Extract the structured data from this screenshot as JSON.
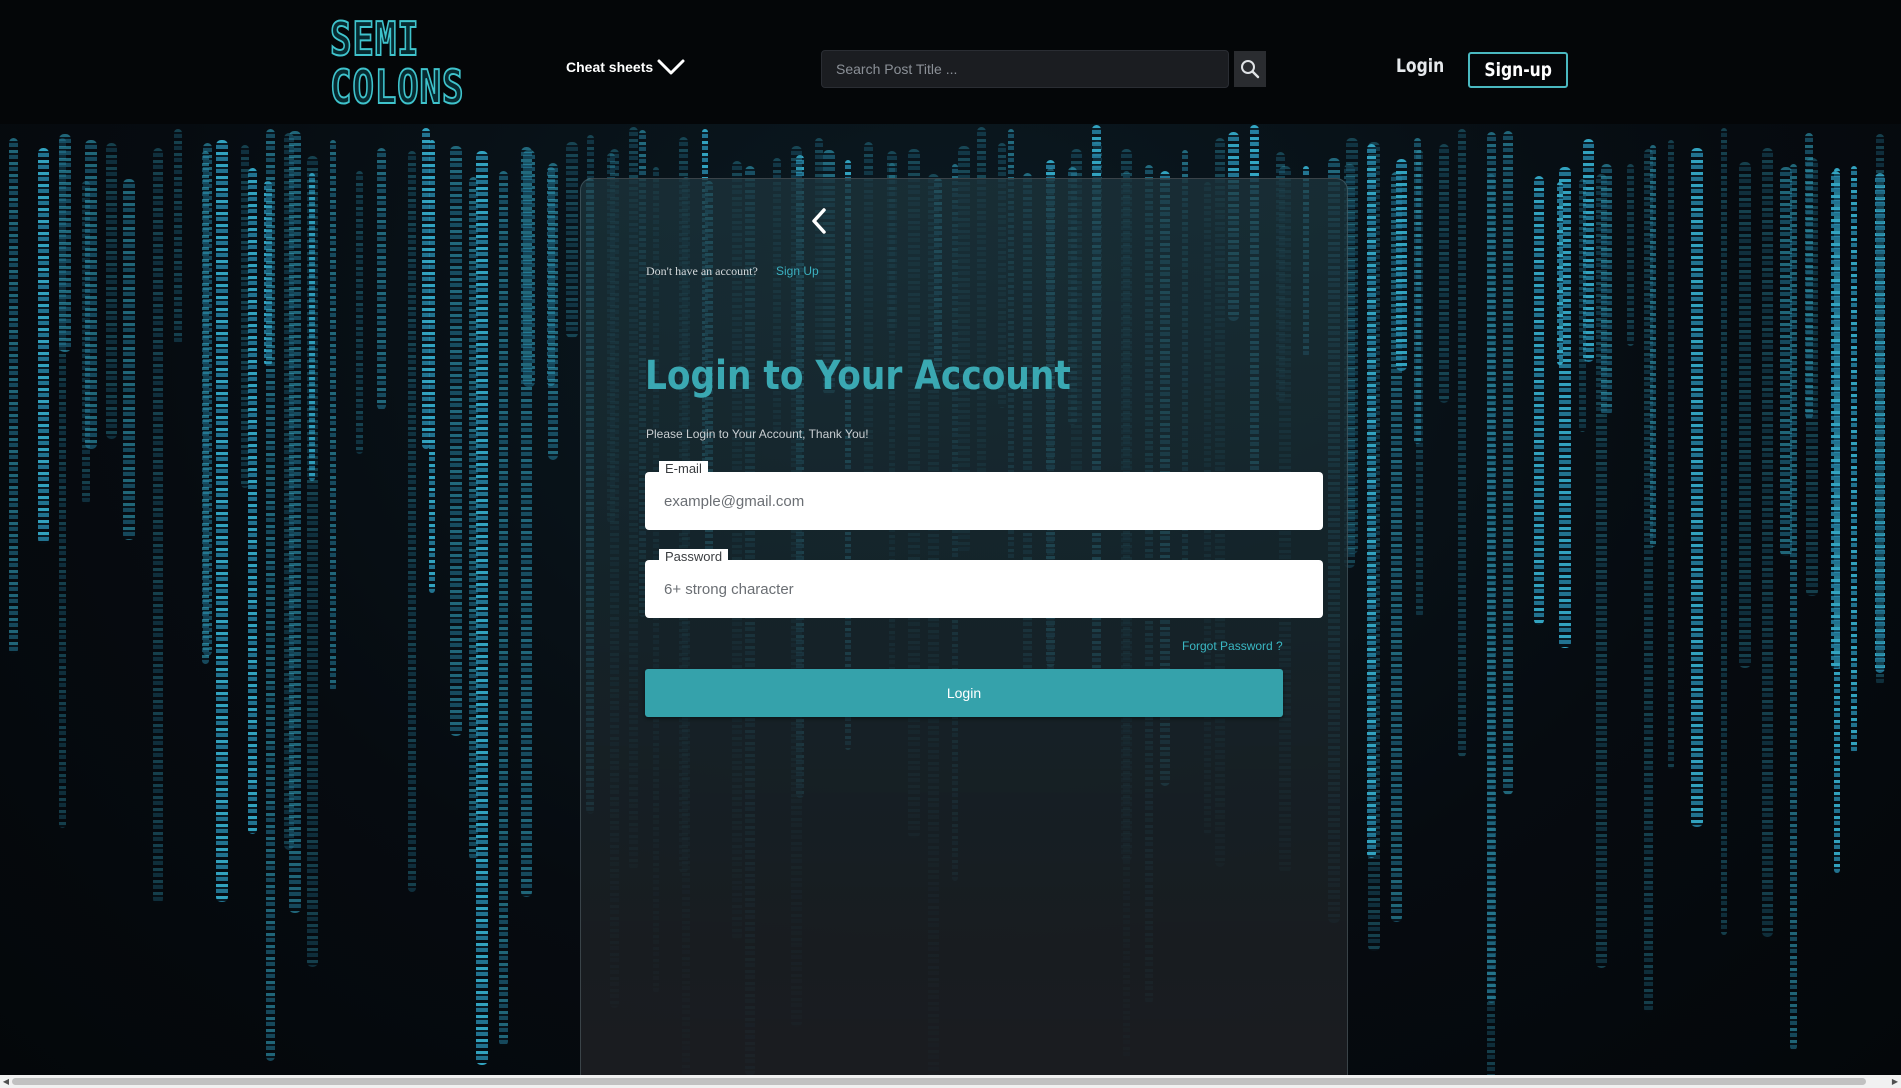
{
  "header": {
    "logo_line1": "SEMI",
    "logo_line2": "COLONS",
    "cheat_sheets_label": "Cheat sheets",
    "search_placeholder": "Search Post Title ...",
    "login_label": "Login",
    "signup_label": "Sign-up"
  },
  "card": {
    "no_account_text": "Don't have an account?",
    "signup_link": "Sign Up",
    "title": "Login to Your Account",
    "subtitle": "Please Login to Your Account, Thank You!",
    "email": {
      "label": "E-mail",
      "placeholder": "example@gmail.com",
      "value": ""
    },
    "password": {
      "label": "Password",
      "placeholder": "6+ strong character",
      "value": ""
    },
    "forgot_password": "Forgot Password ?",
    "login_button": "Login"
  },
  "icons": {
    "chevron_down": "chevron-down-icon",
    "search": "search-icon",
    "back": "chevron-left-icon"
  },
  "colors": {
    "accent": "#35a2ab",
    "title": "#3aa8b2",
    "link": "#3ab0c0",
    "header_bg": "#040608",
    "matrix_glyph": "#34aac8"
  }
}
